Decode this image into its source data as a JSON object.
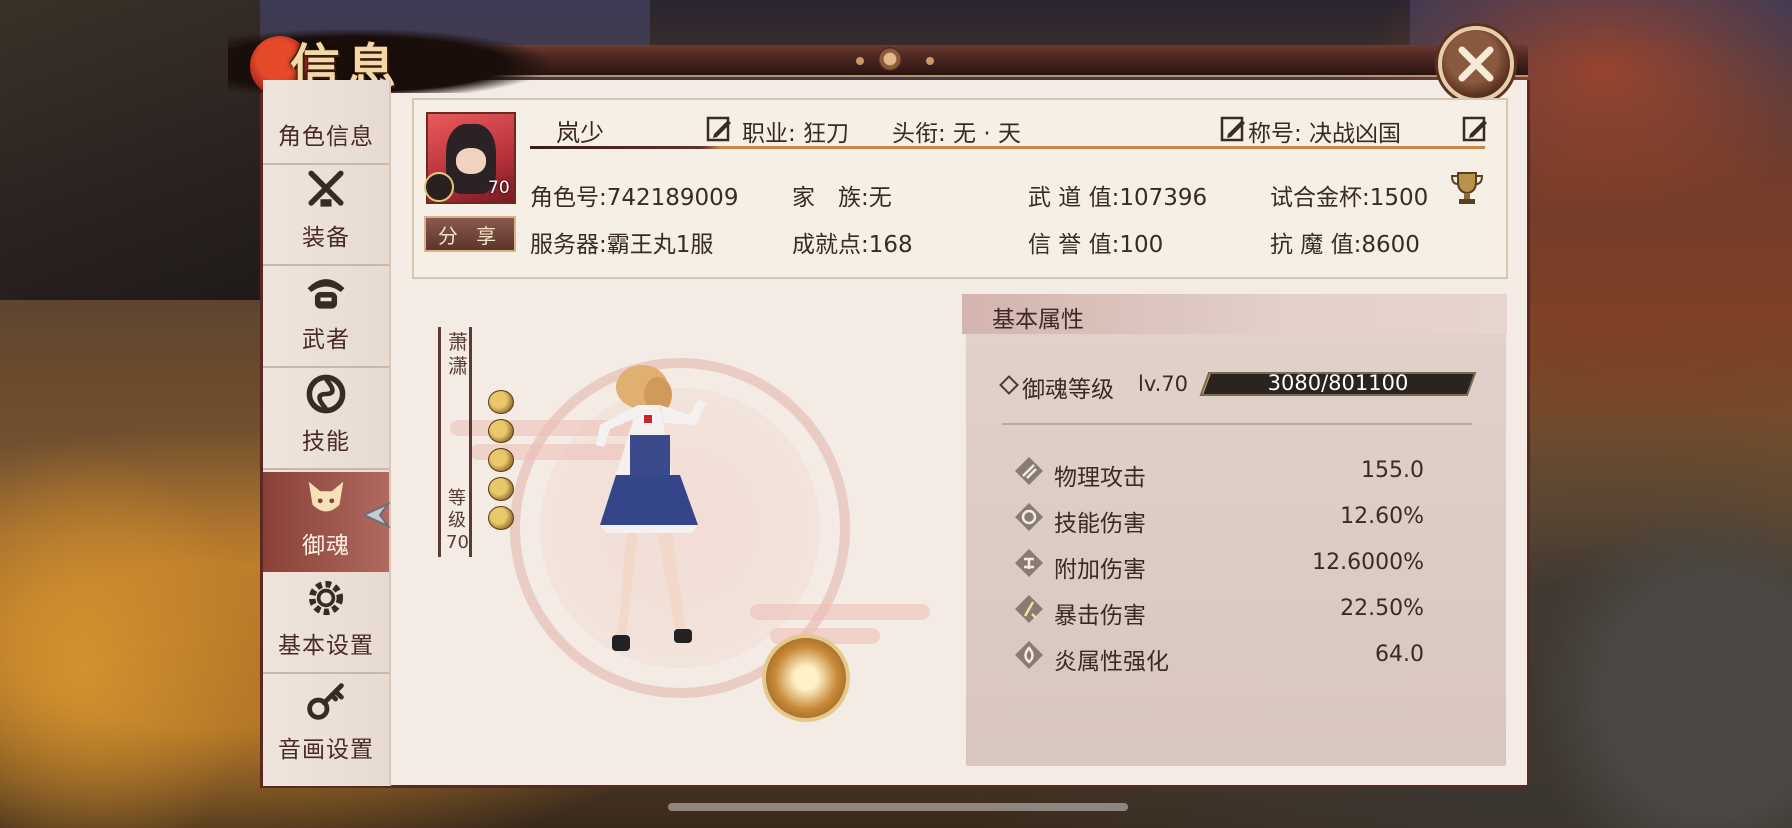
{
  "window": {
    "title": "信息",
    "close_icon": "close-icon"
  },
  "sidebar": {
    "items": [
      {
        "label": "角色信息",
        "icon": "character-icon"
      },
      {
        "label": "装备",
        "icon": "swords-icon"
      },
      {
        "label": "武者",
        "icon": "samurai-helmet-icon"
      },
      {
        "label": "技能",
        "icon": "swirl-icon"
      },
      {
        "label": "御魂",
        "icon": "fox-spirit-icon",
        "active": true
      },
      {
        "label": "基本设置",
        "icon": "gear-icon"
      },
      {
        "label": "音画设置",
        "icon": "key-icon"
      }
    ]
  },
  "profile": {
    "name": "岚少",
    "level": "70",
    "share_label": "分 享",
    "job": "职业: 狂刀",
    "rank_title": "头衔: 无 · 天",
    "nickname": "称号: 决战凶国",
    "role_id": "角色号:742189009",
    "family": "家　族:无",
    "martial": "武 道 值:107396",
    "trial_cup": "试合金杯:1500",
    "server": "服务器:霸王丸1服",
    "achievement": "成就点:168",
    "honor": "信 誉 值:100",
    "demon_resist": "抗 魔 值:8600"
  },
  "character": {
    "vertical_name": "萧潇",
    "vertical_level": "等级70",
    "coin_count": 5
  },
  "attributes": {
    "title": "基本属性",
    "soul_label": "御魂等级",
    "soul_level": "lv.70",
    "soul_exp": "3080/801100",
    "soul_progress": 0.0038,
    "stats": [
      {
        "name": "物理攻击",
        "value": "155.0",
        "icon": "attack-icon"
      },
      {
        "name": "技能伤害",
        "value": "12.60%",
        "icon": "skill-damage-icon"
      },
      {
        "name": "附加伤害",
        "value": "12.6000%",
        "icon": "extra-damage-icon"
      },
      {
        "name": "暴击伤害",
        "value": "22.50%",
        "icon": "crit-damage-icon"
      },
      {
        "name": "炎属性强化",
        "value": "64.0",
        "icon": "fire-icon"
      }
    ]
  },
  "colors": {
    "frame_dark": "#5a2a22",
    "panel_bg": "#f3ebe4",
    "accent_gold": "#c8884a",
    "active_tab": "#8a4038"
  }
}
